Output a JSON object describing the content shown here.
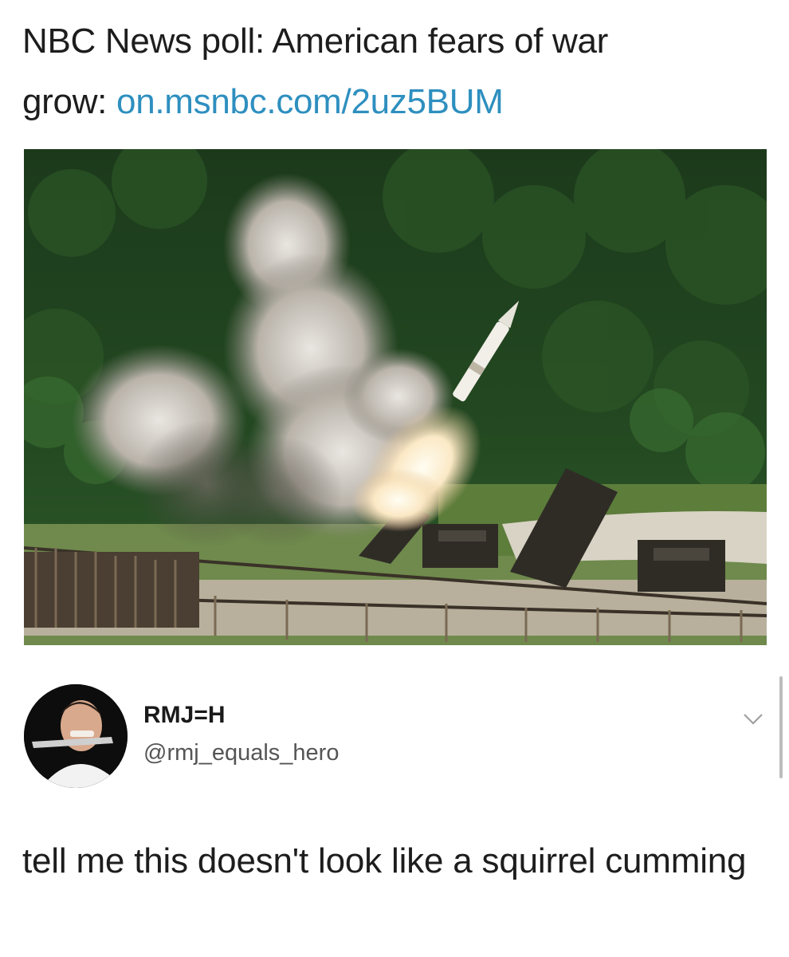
{
  "quoted_tweet": {
    "headline_text": "NBC News poll: American fears of war",
    "headline_text_2": "grow: ",
    "link": "on.msnbc.com/2uz5BUM"
  },
  "media": {
    "image_icon": "photo-missile-launch"
  },
  "tweet": {
    "display_name": "RMJ=H",
    "handle": "@rmj_equals_hero",
    "text": "tell me this doesn't look like a squirrel cumming",
    "menu_icon": "chevron-down-icon"
  },
  "colors": {
    "link": "#2e8fbf",
    "text": "#1d1d1d",
    "handle": "#555555"
  }
}
